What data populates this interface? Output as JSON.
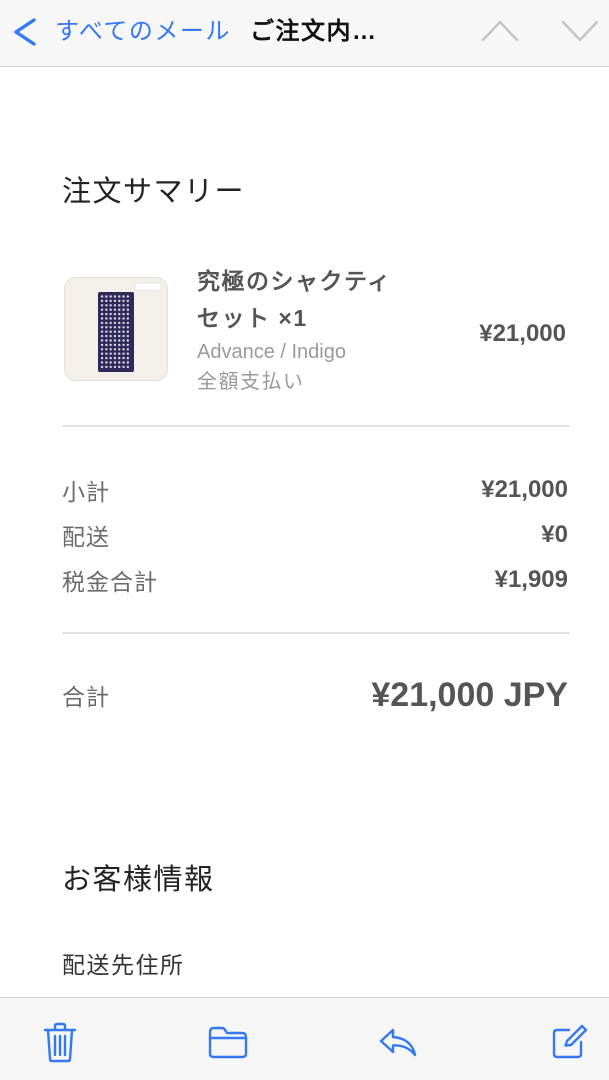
{
  "nav": {
    "back_icon": "chevron-left-icon",
    "back_label": "すべてのメール",
    "title": "ご注文内…",
    "prev_icon": "chevron-up-icon",
    "next_icon": "chevron-down-icon"
  },
  "order_summary": {
    "heading": "注文サマリー",
    "items": [
      {
        "name": "究極のシャクティセット ×1",
        "variant": "Advance / Indigo",
        "payment": "全額支払い",
        "price": "¥21,000"
      }
    ]
  },
  "totals": {
    "rows": [
      {
        "label": "小計",
        "value": "¥21,000"
      },
      {
        "label": "配送",
        "value": "¥0"
      },
      {
        "label": "税金合計",
        "value": "¥1,909"
      }
    ],
    "total": {
      "label": "合計",
      "value": "¥21,000 JPY"
    }
  },
  "customer_info": {
    "heading": "お客様情報",
    "shipping_address_label": "配送先住所"
  },
  "toolbar": {
    "items": [
      {
        "icon": "trash-icon"
      },
      {
        "icon": "folder-icon"
      },
      {
        "icon": "reply-icon"
      },
      {
        "icon": "compose-icon"
      }
    ]
  },
  "colors": {
    "accent": "#3478f6",
    "muted_chevron": "#c4c4c4",
    "label_text": "#6b6b6b",
    "value_text": "#555555"
  }
}
